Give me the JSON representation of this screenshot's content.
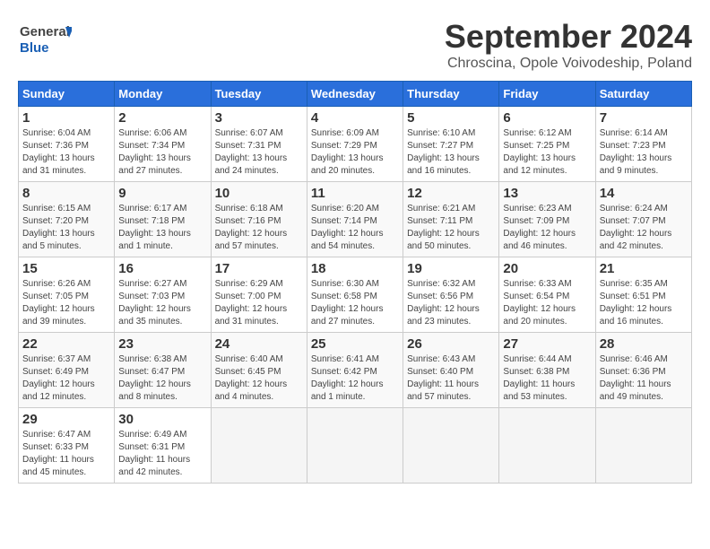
{
  "header": {
    "logo_general": "General",
    "logo_blue": "Blue",
    "month_year": "September 2024",
    "location": "Chroscina, Opole Voivodeship, Poland"
  },
  "weekdays": [
    "Sunday",
    "Monday",
    "Tuesday",
    "Wednesday",
    "Thursday",
    "Friday",
    "Saturday"
  ],
  "weeks": [
    [
      {
        "day": "1",
        "sunrise": "6:04 AM",
        "sunset": "7:36 PM",
        "daylight": "13 hours and 31 minutes."
      },
      {
        "day": "2",
        "sunrise": "6:06 AM",
        "sunset": "7:34 PM",
        "daylight": "13 hours and 27 minutes."
      },
      {
        "day": "3",
        "sunrise": "6:07 AM",
        "sunset": "7:31 PM",
        "daylight": "13 hours and 24 minutes."
      },
      {
        "day": "4",
        "sunrise": "6:09 AM",
        "sunset": "7:29 PM",
        "daylight": "13 hours and 20 minutes."
      },
      {
        "day": "5",
        "sunrise": "6:10 AM",
        "sunset": "7:27 PM",
        "daylight": "13 hours and 16 minutes."
      },
      {
        "day": "6",
        "sunrise": "6:12 AM",
        "sunset": "7:25 PM",
        "daylight": "13 hours and 12 minutes."
      },
      {
        "day": "7",
        "sunrise": "6:14 AM",
        "sunset": "7:23 PM",
        "daylight": "13 hours and 9 minutes."
      }
    ],
    [
      {
        "day": "8",
        "sunrise": "6:15 AM",
        "sunset": "7:20 PM",
        "daylight": "13 hours and 5 minutes."
      },
      {
        "day": "9",
        "sunrise": "6:17 AM",
        "sunset": "7:18 PM",
        "daylight": "13 hours and 1 minute."
      },
      {
        "day": "10",
        "sunrise": "6:18 AM",
        "sunset": "7:16 PM",
        "daylight": "12 hours and 57 minutes."
      },
      {
        "day": "11",
        "sunrise": "6:20 AM",
        "sunset": "7:14 PM",
        "daylight": "12 hours and 54 minutes."
      },
      {
        "day": "12",
        "sunrise": "6:21 AM",
        "sunset": "7:11 PM",
        "daylight": "12 hours and 50 minutes."
      },
      {
        "day": "13",
        "sunrise": "6:23 AM",
        "sunset": "7:09 PM",
        "daylight": "12 hours and 46 minutes."
      },
      {
        "day": "14",
        "sunrise": "6:24 AM",
        "sunset": "7:07 PM",
        "daylight": "12 hours and 42 minutes."
      }
    ],
    [
      {
        "day": "15",
        "sunrise": "6:26 AM",
        "sunset": "7:05 PM",
        "daylight": "12 hours and 39 minutes."
      },
      {
        "day": "16",
        "sunrise": "6:27 AM",
        "sunset": "7:03 PM",
        "daylight": "12 hours and 35 minutes."
      },
      {
        "day": "17",
        "sunrise": "6:29 AM",
        "sunset": "7:00 PM",
        "daylight": "12 hours and 31 minutes."
      },
      {
        "day": "18",
        "sunrise": "6:30 AM",
        "sunset": "6:58 PM",
        "daylight": "12 hours and 27 minutes."
      },
      {
        "day": "19",
        "sunrise": "6:32 AM",
        "sunset": "6:56 PM",
        "daylight": "12 hours and 23 minutes."
      },
      {
        "day": "20",
        "sunrise": "6:33 AM",
        "sunset": "6:54 PM",
        "daylight": "12 hours and 20 minutes."
      },
      {
        "day": "21",
        "sunrise": "6:35 AM",
        "sunset": "6:51 PM",
        "daylight": "12 hours and 16 minutes."
      }
    ],
    [
      {
        "day": "22",
        "sunrise": "6:37 AM",
        "sunset": "6:49 PM",
        "daylight": "12 hours and 12 minutes."
      },
      {
        "day": "23",
        "sunrise": "6:38 AM",
        "sunset": "6:47 PM",
        "daylight": "12 hours and 8 minutes."
      },
      {
        "day": "24",
        "sunrise": "6:40 AM",
        "sunset": "6:45 PM",
        "daylight": "12 hours and 4 minutes."
      },
      {
        "day": "25",
        "sunrise": "6:41 AM",
        "sunset": "6:42 PM",
        "daylight": "12 hours and 1 minute."
      },
      {
        "day": "26",
        "sunrise": "6:43 AM",
        "sunset": "6:40 PM",
        "daylight": "11 hours and 57 minutes."
      },
      {
        "day": "27",
        "sunrise": "6:44 AM",
        "sunset": "6:38 PM",
        "daylight": "11 hours and 53 minutes."
      },
      {
        "day": "28",
        "sunrise": "6:46 AM",
        "sunset": "6:36 PM",
        "daylight": "11 hours and 49 minutes."
      }
    ],
    [
      {
        "day": "29",
        "sunrise": "6:47 AM",
        "sunset": "6:33 PM",
        "daylight": "11 hours and 45 minutes."
      },
      {
        "day": "30",
        "sunrise": "6:49 AM",
        "sunset": "6:31 PM",
        "daylight": "11 hours and 42 minutes."
      },
      null,
      null,
      null,
      null,
      null
    ]
  ]
}
